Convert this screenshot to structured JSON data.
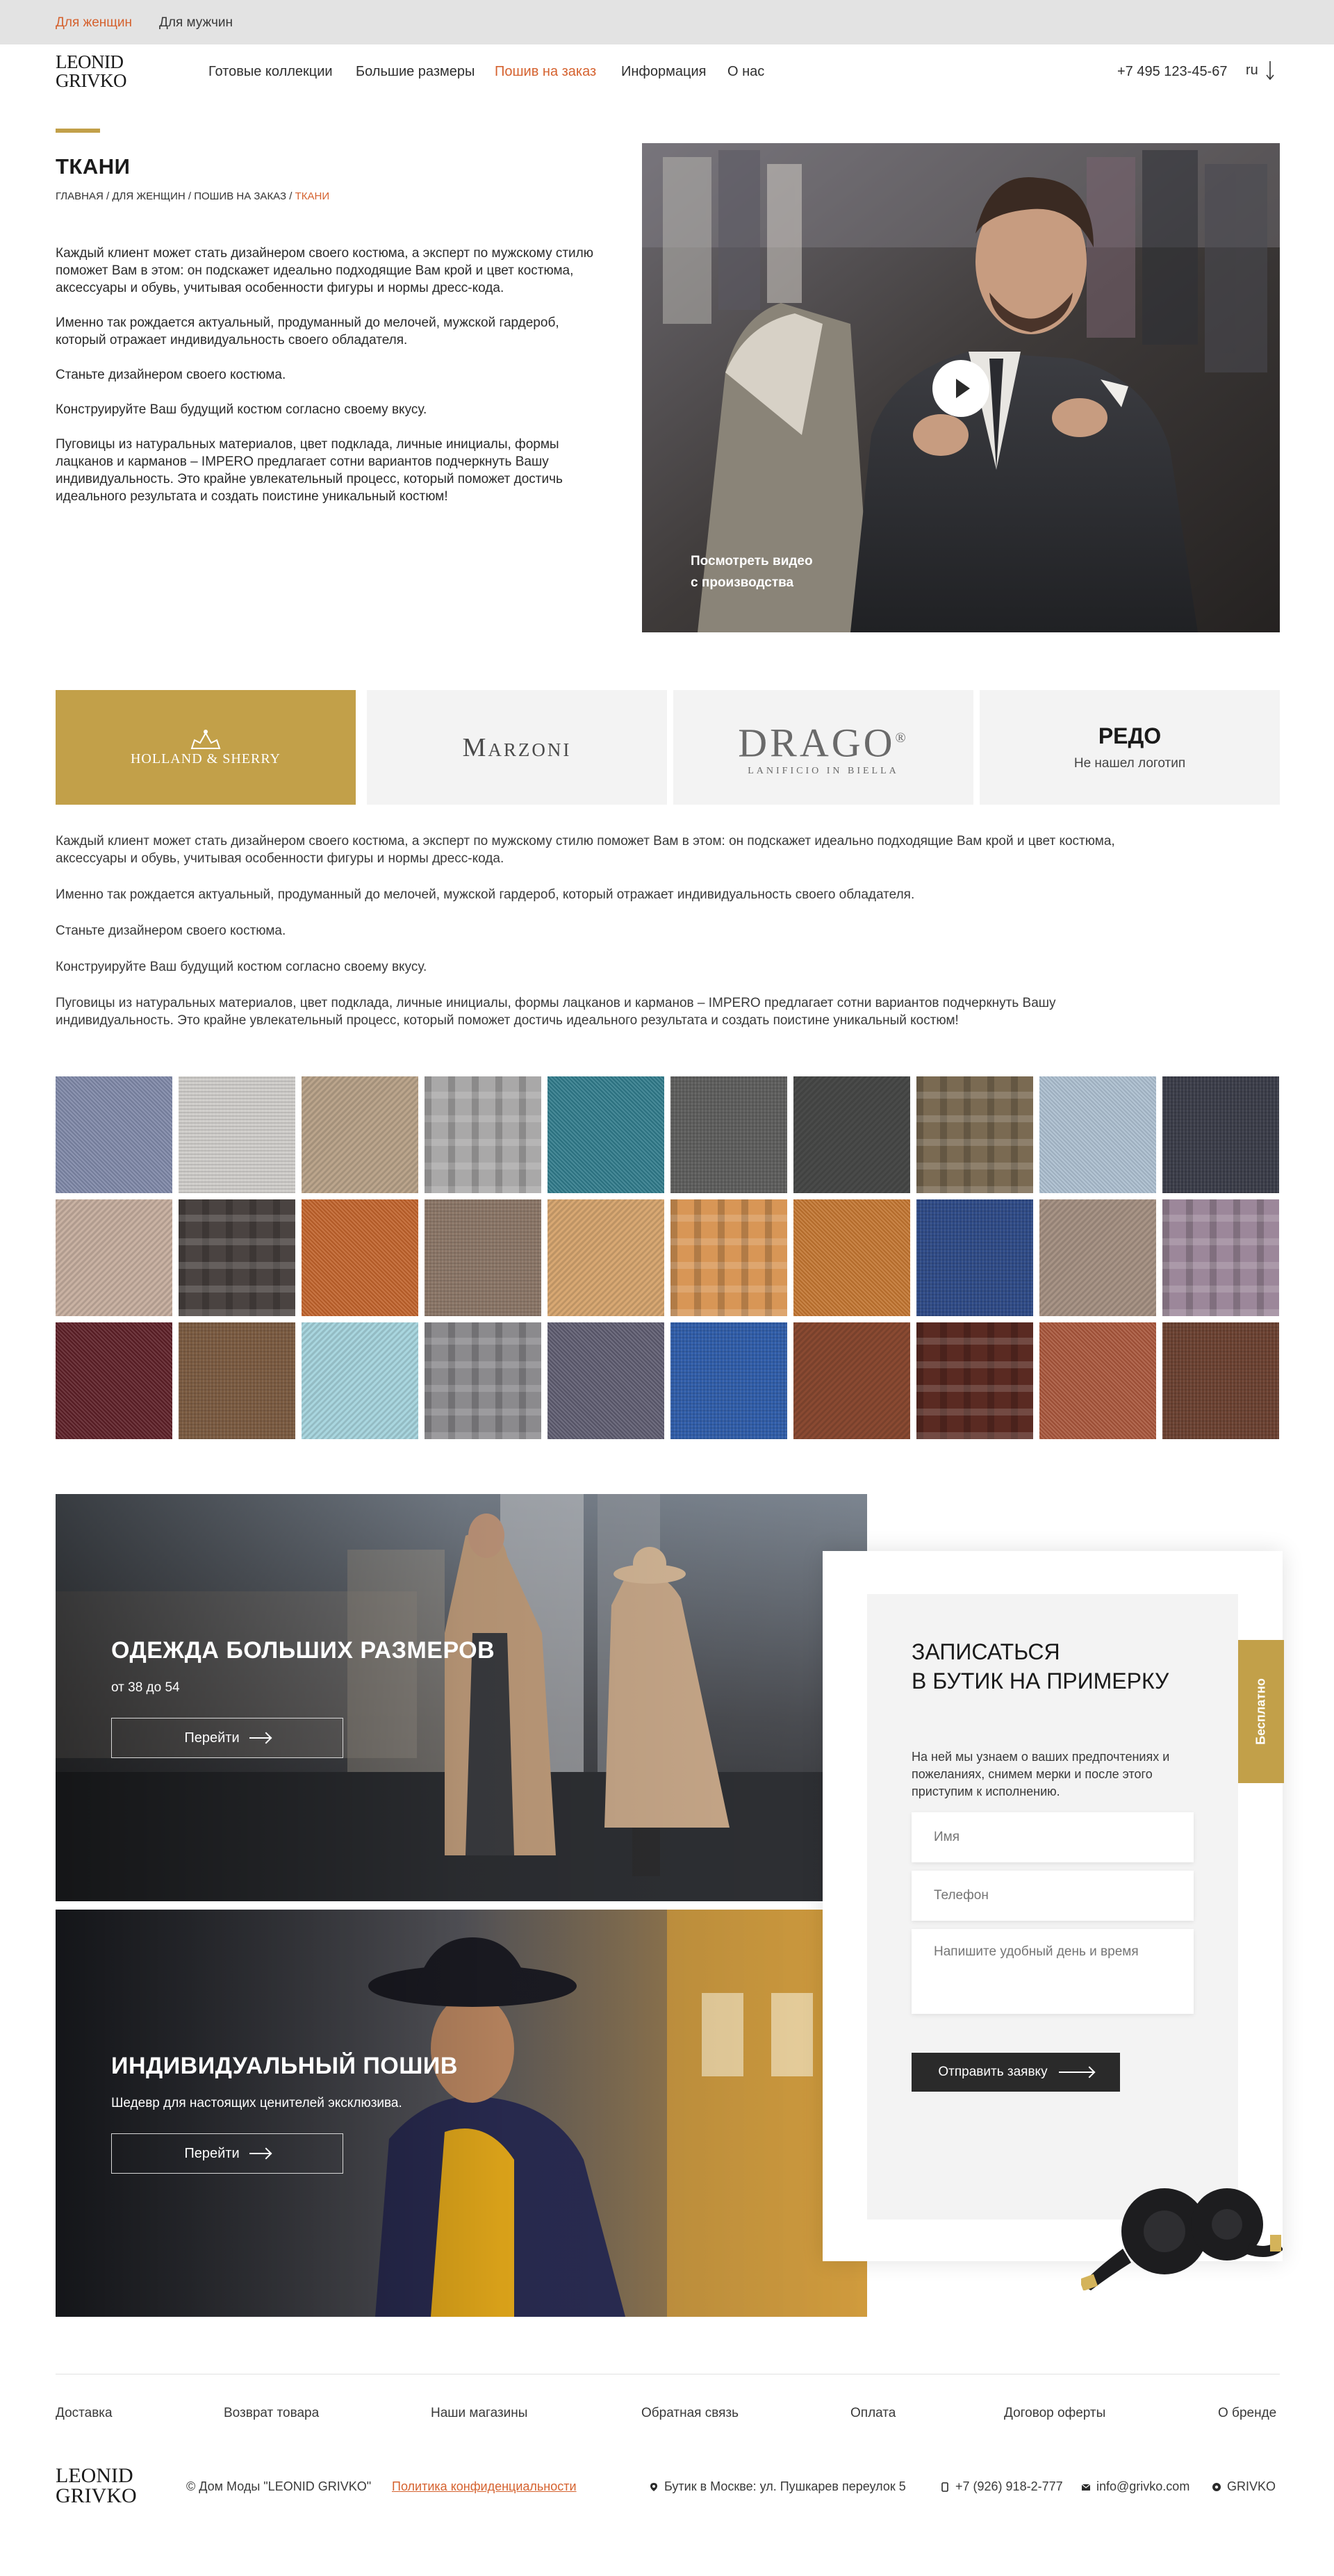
{
  "topbar": {
    "women": "Для женщин",
    "men": "Для мужчин"
  },
  "header": {
    "logo_line1": "LEONID",
    "logo_line2": "GRIVKO",
    "nav": [
      "Готовые коллекции",
      "Большие размеры",
      "Пошив на заказ",
      "Информация",
      "О нас"
    ],
    "phone": "+7 495 123-45-67",
    "lang": "ru"
  },
  "page": {
    "title": "ТКАНИ",
    "breadcrumb": {
      "home": "ГЛАВНАЯ",
      "section": "ДЛЯ ЖЕНЩИН",
      "sub": "ПОШИВ НА ЗАКАЗ",
      "current": "ТКАНИ",
      "sep": " / "
    },
    "intro": [
      "Каждый клиент может стать дизайнером своего костюма, а эксперт по мужскому стилю поможет Вам в этом: он подскажет идеально подходящие Вам крой и цвет костюма, аксессуары и обувь, учитывая особенности фигуры и нормы дресс-кода.",
      "Именно так рождается актуальный, продуманный до мелочей, мужской гардероб, который отражает индивидуальность своего обладателя.",
      "Станьте дизайнером своего костюма.",
      "Конструируйте Ваш будущий костюм согласно своему вкусу.",
      "Пуговицы из натуральных материалов, цвет подклада, личные инициалы, формы лацканов и карманов – IMPERO предлагает сотни вариантов подчеркнуть Вашу индивидуальность. Это крайне увлекательный процесс, который поможет достичь идеального результата и создать поистине уникальный костюм!"
    ],
    "video_caption_1": "Посмотреть видео",
    "video_caption_2": "с производства"
  },
  "brands": {
    "holland": "HOLLAND & SHERRY",
    "marzoni": "Marzoni",
    "drago": "DRAGO",
    "drago_mark": "®",
    "drago_sub": "LANIFICIO IN BIELLA",
    "redo": "РЕДО",
    "redo_note": "Не нашел логотип"
  },
  "body2": [
    "Каждый клиент может стать дизайнером своего костюма, а эксперт по мужскому стилю поможет Вам в этом: он подскажет идеально подходящие Вам крой и цвет костюма, аксессуары и обувь, учитывая особенности фигуры и нормы дресс-кода.",
    "Именно так рождается актуальный, продуманный до мелочей, мужской гардероб, который отражает индивидуальность своего обладателя.",
    "Станьте дизайнером своего костюма.",
    "Конструируйте Ваш будущий костюм согласно своему вкусу.",
    "Пуговицы из натуральных материалов, цвет подклада, личные инициалы, формы лацканов и карманов – IMPERO предлагает сотни вариантов подчеркнуть Вашу индивидуальность. Это крайне увлекательный процесс, который поможет достичь идеального результата и создать поистине уникальный костюм!"
  ],
  "swatch_colors": [
    "#7d86a6",
    "#cfcdca",
    "#bba58c",
    "#a9a8a8",
    "#2f7a8a",
    "#5d5d5c",
    "#4a4b4a",
    "#7a6a52",
    "#aabdce",
    "#3a3c48",
    "#c9b2a3",
    "#4a4341",
    "#c0622a",
    "#8a7566",
    "#d8a873",
    "#d89656",
    "#c2742f",
    "#2e4a86",
    "#a89486",
    "#9c879a",
    "#5c1e26",
    "#7a5a40",
    "#a9d6df",
    "#8b8a8d",
    "#5c5a6e",
    "#2f5ca8",
    "#8a4a32",
    "#5a2a22",
    "#a8553a",
    "#6a4030"
  ],
  "promo1": {
    "title": "ОДЕЖДА БОЛЬШИХ РАЗМЕРОВ",
    "subtitle": "от 38 до 54",
    "button": "Перейти"
  },
  "promo2": {
    "title": "ИНДИВИДУАЛЬНЫЙ ПОШИВ",
    "subtitle": "Шедевр для настоящих ценителей эксклюзива.",
    "button": "Перейти"
  },
  "form": {
    "title_line1": "ЗАПИСАТЬСЯ",
    "title_line2": "В БУТИК НА ПРИМЕРКУ",
    "desc": "На ней мы узнаем о ваших предпочтениях и пожеланиях, снимем мерки и после этого приступим к исполнению.",
    "name_placeholder": "Имя",
    "phone_placeholder": "Телефон",
    "time_placeholder": "Напишите удобный день и время",
    "submit": "Отправить заявку",
    "free_tab": "Бесплатно"
  },
  "footer": {
    "links": [
      "Доставка",
      "Возврат товара",
      "Наши магазины",
      "Обратная связь",
      "Оплата",
      "Договор оферты",
      "О бренде"
    ],
    "logo_line1": "LEONID",
    "logo_line2": "GRIVKO",
    "copyright": "© Дом Моды \"LEONID GRIVKO\"",
    "privacy": "Политика конфиденциальности",
    "address": "Бутик в Москве: ул. Пушкарев переулок 5",
    "phone": "+7 (926) 918-2-777",
    "email": "info@grivko.com",
    "social": "GRIVKO"
  }
}
